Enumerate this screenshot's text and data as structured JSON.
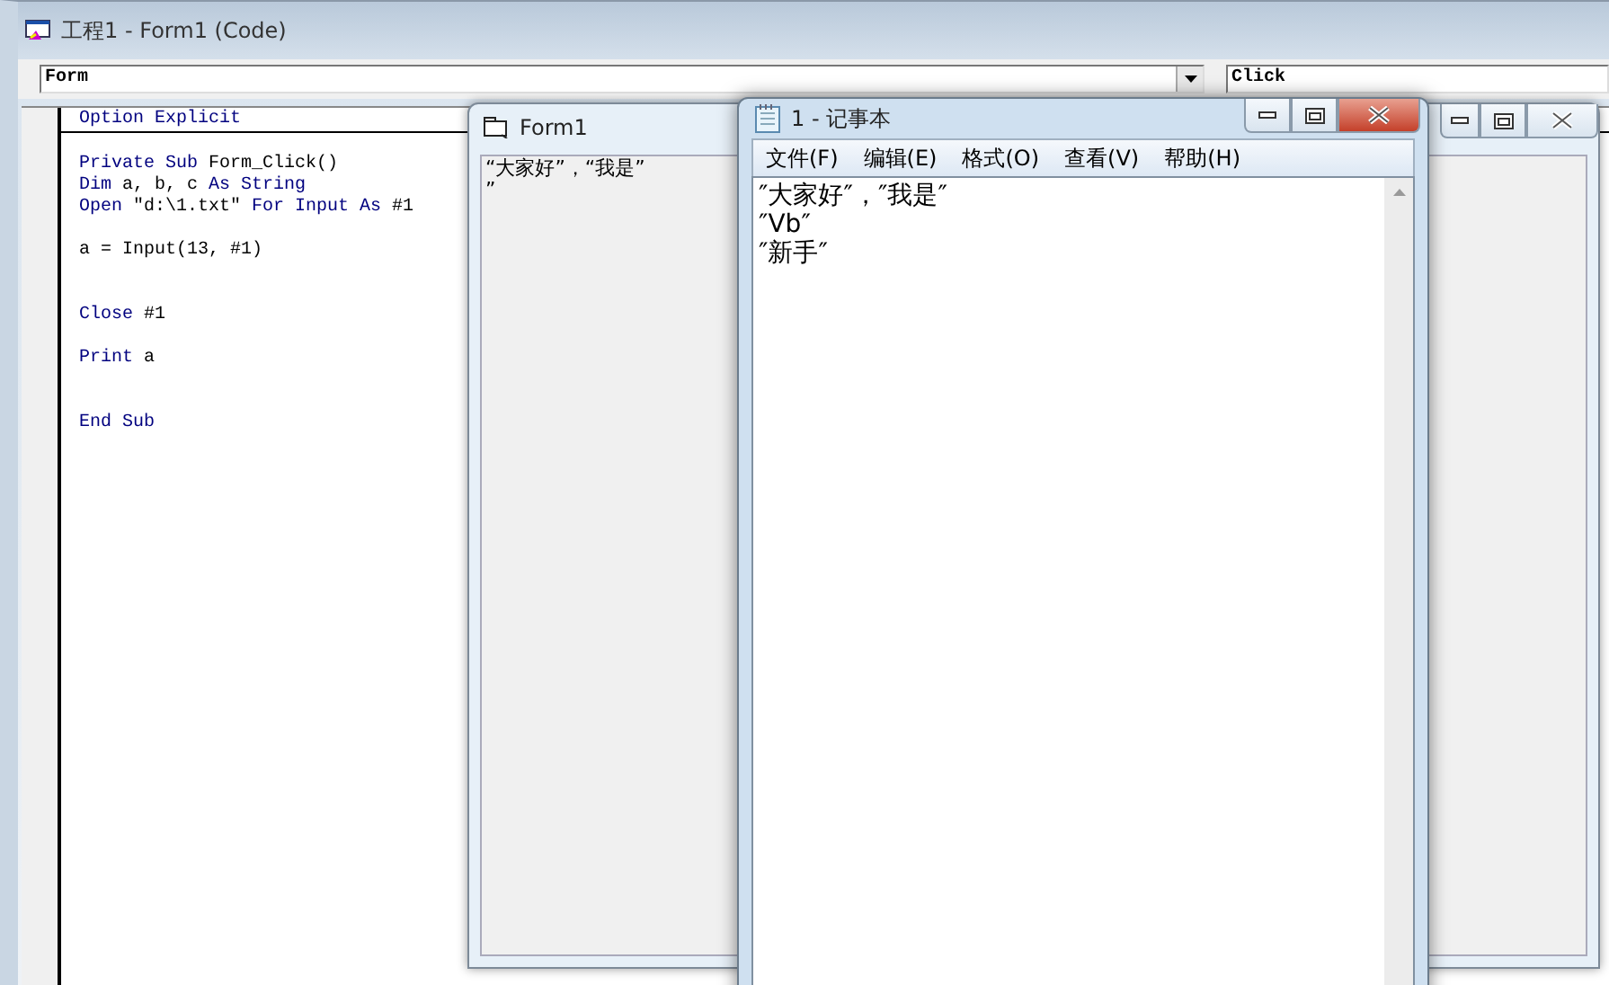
{
  "ide_window": {
    "title": "工程1 - Form1 (Code)",
    "object_combo": "Form",
    "procedure_combo": "Click",
    "declarations": [
      {
        "kind": "code",
        "tokens": [
          {
            "text": "Option Explicit",
            "kind": "keyword"
          }
        ]
      }
    ],
    "procedure_lines": [
      {
        "kind": "blank"
      },
      {
        "kind": "code",
        "tokens": [
          {
            "text": "Private Sub",
            "kind": "keyword"
          },
          {
            "text": " Form_Click()",
            "kind": "plain"
          }
        ]
      },
      {
        "kind": "code",
        "tokens": [
          {
            "text": "Dim",
            "kind": "keyword"
          },
          {
            "text": " a, b, c ",
            "kind": "plain"
          },
          {
            "text": "As String",
            "kind": "keyword"
          }
        ]
      },
      {
        "kind": "code",
        "tokens": [
          {
            "text": "Open",
            "kind": "keyword"
          },
          {
            "text": " \"d:\\1.txt\" ",
            "kind": "plain"
          },
          {
            "text": "For Input As",
            "kind": "keyword"
          },
          {
            "text": " #1",
            "kind": "plain"
          }
        ]
      },
      {
        "kind": "blank"
      },
      {
        "kind": "code",
        "tokens": [
          {
            "text": "a = Input(13, #1)",
            "kind": "plain"
          }
        ]
      },
      {
        "kind": "blank"
      },
      {
        "kind": "blank"
      },
      {
        "kind": "code",
        "tokens": [
          {
            "text": "Close",
            "kind": "keyword"
          },
          {
            "text": " #1",
            "kind": "plain"
          }
        ]
      },
      {
        "kind": "blank"
      },
      {
        "kind": "code",
        "tokens": [
          {
            "text": "Print",
            "kind": "keyword"
          },
          {
            "text": " a",
            "kind": "plain"
          }
        ]
      },
      {
        "kind": "blank"
      },
      {
        "kind": "blank"
      },
      {
        "kind": "code",
        "tokens": [
          {
            "text": "End Sub",
            "kind": "keyword"
          }
        ]
      }
    ]
  },
  "form_window": {
    "title": "Form1",
    "output_lines": [
      "“大家好”，“我是”",
      "”"
    ]
  },
  "notepad": {
    "title": "1 - 记事本",
    "menu": [
      "文件(F)",
      "编辑(E)",
      "格式(O)",
      "查看(V)",
      "帮助(H)"
    ],
    "text_lines": [
      "″大家好″，″我是″",
      "″Vb″",
      "″新手″"
    ]
  }
}
